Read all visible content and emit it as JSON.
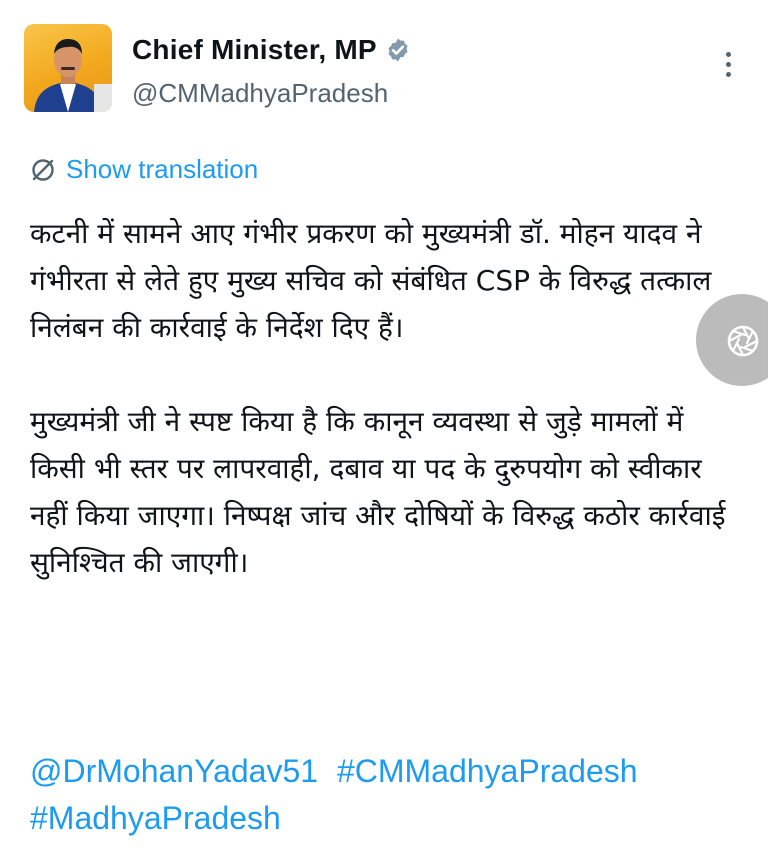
{
  "author": {
    "display_name": "Chief Minister, MP",
    "handle": "@CMMadhyaPradesh",
    "verified": true
  },
  "translate": {
    "label": "Show translation",
    "icon": "translate-icon"
  },
  "post": {
    "paragraphs": [
      "कटनी में सामने आए गंभीर प्रकरण को मुख्यमंत्री डॉ. मोहन यादव ने गंभीरता से लेते हुए मुख्य सचिव को संबंधित CSP के विरुद्ध तत्काल निलंबन की कार्रवाई के निर्देश दिए हैं।",
      "मुख्यमंत्री जी ने स्पष्ट किया है कि कानून व्यवस्था से जुड़े मामलों में किसी भी स्तर पर लापरवाही, दबाव या पद के दुरुपयोग को स्वीकार नहीं किया जाएगा। निष्पक्ष जांच और दोषियों के विरुद्ध कठोर कार्रवाई सुनिश्चित की जाएगी।"
    ],
    "mentions": [
      "@DrMohanYadav51",
      "#CMMadhyaPradesh",
      "#MadhyaPradesh"
    ]
  },
  "colors": {
    "accent": "#1d9bf0",
    "text": "#0f1419",
    "muted": "#536471",
    "avatar_bg": "#f2a81d"
  }
}
